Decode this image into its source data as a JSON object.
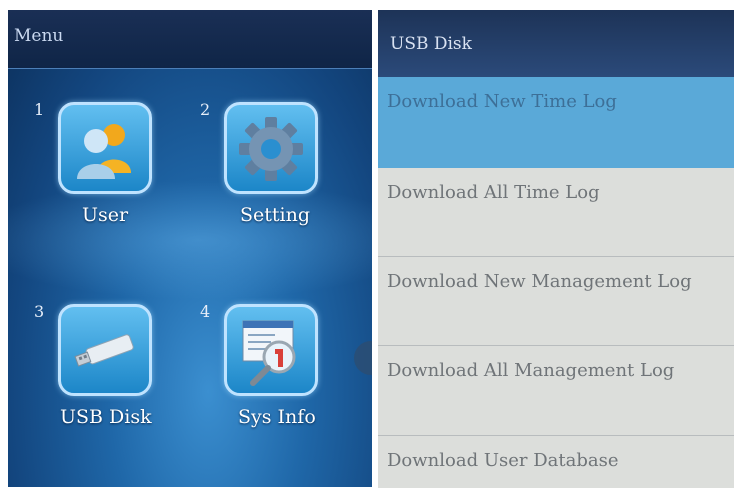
{
  "left": {
    "title": "Menu",
    "tiles": [
      {
        "number": "1",
        "label": "User",
        "icon": "users-icon"
      },
      {
        "number": "2",
        "label": "Setting",
        "icon": "gear-icon"
      },
      {
        "number": "3",
        "label": "USB Disk",
        "icon": "usb-drive-icon"
      },
      {
        "number": "4",
        "label": "Sys Info",
        "icon": "system-info-icon"
      }
    ]
  },
  "right": {
    "title": "USB Disk",
    "items": [
      {
        "label": "Download New Time Log",
        "selected": true
      },
      {
        "label": "Download All Time Log",
        "selected": false
      },
      {
        "label": "Download New Management Log",
        "selected": false
      },
      {
        "label": "Download All Management Log",
        "selected": false
      },
      {
        "label": "Download User Database",
        "selected": false
      }
    ]
  },
  "colors": {
    "selected_item": "#5aa9d8",
    "header": "#1d3357",
    "tile_fill": "#3aa6e0"
  }
}
